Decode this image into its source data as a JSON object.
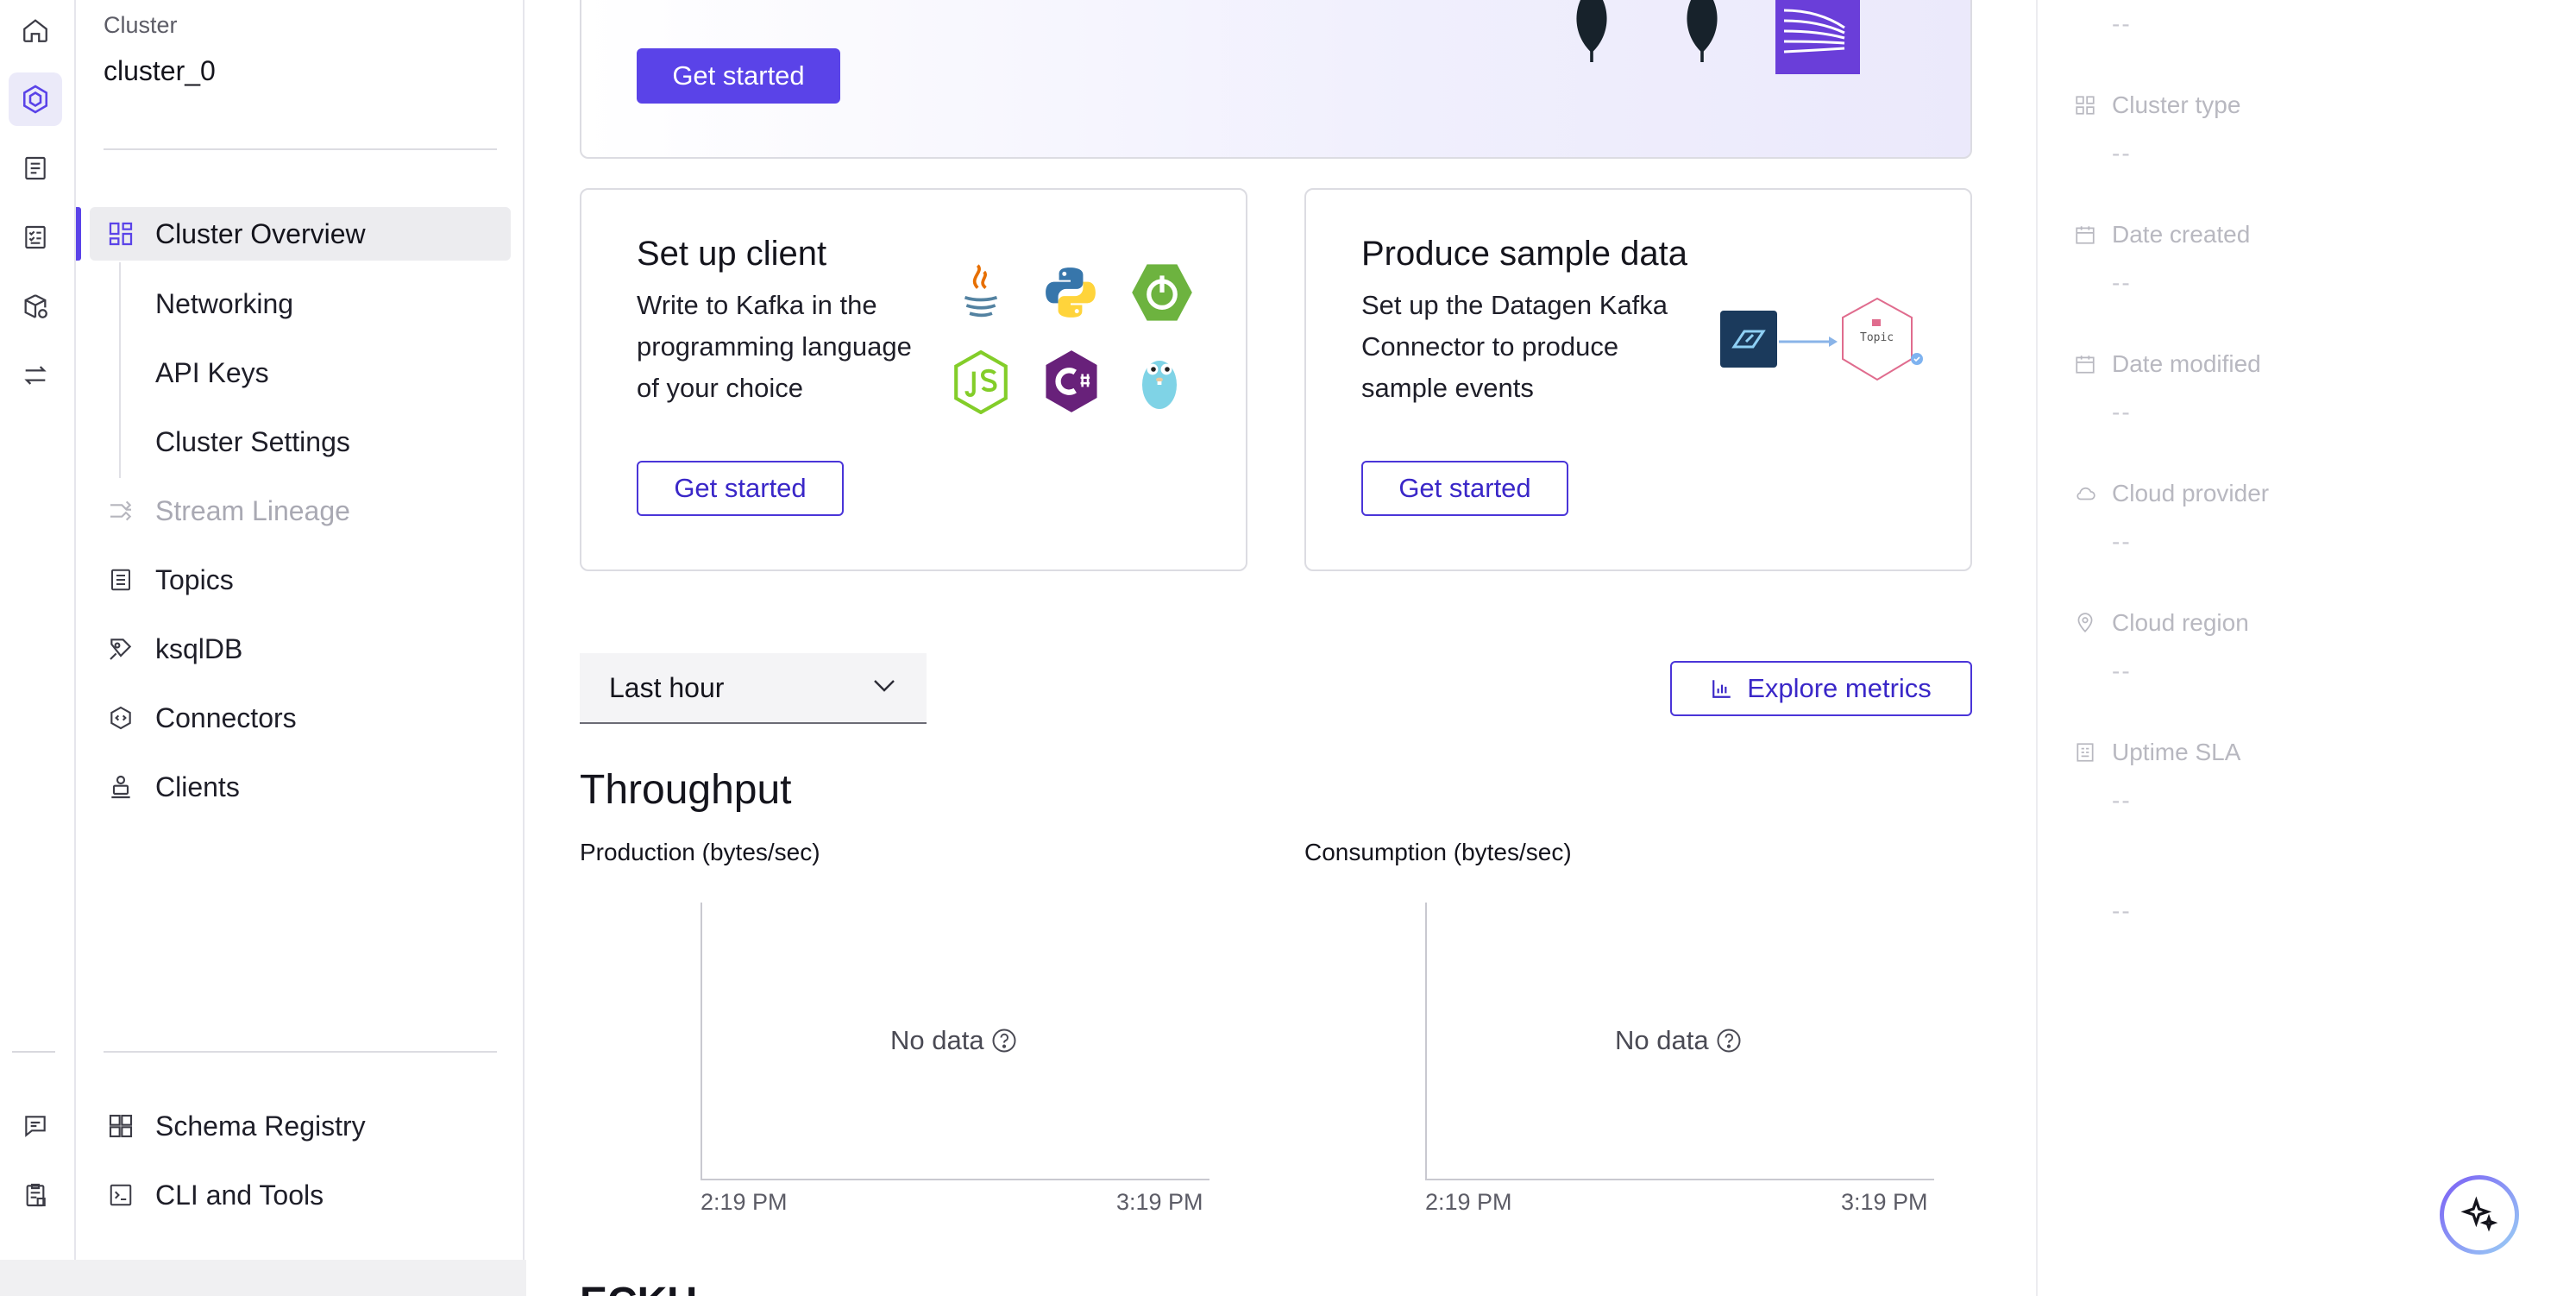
{
  "sidebar": {
    "caption": "Cluster",
    "cluster_name": "cluster_0",
    "items": [
      {
        "label": "Cluster Overview"
      },
      {
        "label": "Networking"
      },
      {
        "label": "API Keys"
      },
      {
        "label": "Cluster Settings"
      },
      {
        "label": "Stream Lineage"
      },
      {
        "label": "Topics"
      },
      {
        "label": "ksqlDB"
      },
      {
        "label": "Connectors"
      },
      {
        "label": "Clients"
      }
    ],
    "footer_items": [
      {
        "label": "Schema Registry"
      },
      {
        "label": "CLI and Tools"
      }
    ]
  },
  "hero": {
    "button_label": "Get started"
  },
  "cards": [
    {
      "title": "Set up client",
      "desc_lines": [
        "Write to Kafka in the",
        "programming language",
        "of your choice"
      ],
      "button_label": "Get started"
    },
    {
      "title": "Produce sample data",
      "desc_lines": [
        "Set up the Datagen Kafka",
        "Connector to produce",
        "sample events"
      ],
      "button_label": "Get started",
      "topic_label": "Topic"
    }
  ],
  "time_range": {
    "selected": "Last hour"
  },
  "explore_metrics_label": "Explore metrics",
  "throughput": {
    "title": "Throughput",
    "charts": [
      {
        "label": "Production (bytes/sec)",
        "empty_text": "No data",
        "x_ticks": [
          "2:19 PM",
          "3:19 PM"
        ]
      },
      {
        "label": "Consumption (bytes/sec)",
        "empty_text": "No data",
        "x_ticks": [
          "2:19 PM",
          "3:19 PM"
        ]
      }
    ]
  },
  "next_section_title": "ECKU",
  "details": {
    "rows": [
      {
        "label": "Cluster type",
        "value": "--",
        "icon": "grid-icon"
      },
      {
        "label": "Date created",
        "value": "--",
        "icon": "calendar-icon"
      },
      {
        "label": "Date modified",
        "value": "--",
        "icon": "calendar-icon"
      },
      {
        "label": "Cloud provider",
        "value": "--",
        "icon": "cloud-icon"
      },
      {
        "label": "Cloud region",
        "value": "--",
        "icon": "location-icon"
      },
      {
        "label": "Uptime SLA",
        "value": "--",
        "icon": "sla-icon"
      }
    ],
    "top_value": "--",
    "extra_value": "--"
  },
  "colors": {
    "accent": "#5a43e8",
    "accent_light": "#ebeaf9",
    "muted": "#b8b8c0"
  }
}
